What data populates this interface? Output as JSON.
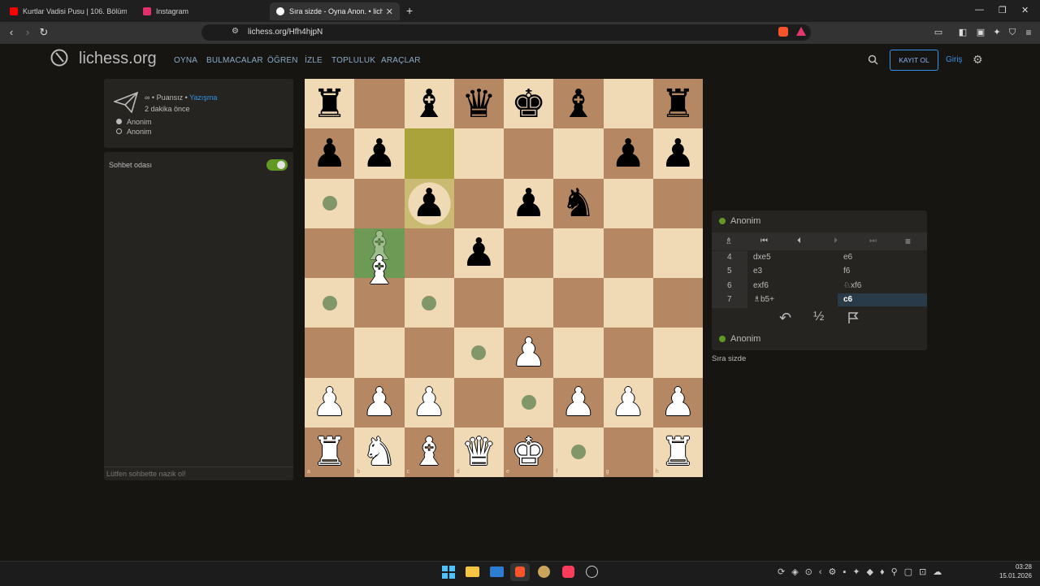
{
  "browser": {
    "tabs": [
      {
        "title": "Kurtlar Vadisi Pusu | 106. Bölüm | Yük",
        "icon": "youtube-icon",
        "color": "#ff0000"
      },
      {
        "title": "Instagram",
        "icon": "instagram-icon",
        "color": "#e1306c"
      },
      {
        "title": "Sıra sizde - Oyna Anon. • lich",
        "icon": "lichess-icon",
        "color": "#ffffff"
      }
    ],
    "url": "lichess.org/Hfh4hjpN"
  },
  "header": {
    "logo": "lichess.org",
    "nav": [
      "OYNA",
      "BULMACALAR",
      "ÖĞREN",
      "İZLE",
      "TOPLULUK",
      "ARAÇLAR"
    ],
    "signup": "KAYIT OL",
    "login": "Giriş"
  },
  "game_info": {
    "mode": "∞ • Puansız • ",
    "mode_link": "Yazışma",
    "time": "2 dakika önce",
    "players": [
      "Anonim",
      "Anonim"
    ]
  },
  "chat": {
    "title": "Sohbet odası",
    "toggle_on": true,
    "placeholder": "Lütfen sohbette nazik ol!"
  },
  "board": {
    "files": [
      "a",
      "b",
      "c",
      "d",
      "e",
      "f",
      "g",
      "h"
    ],
    "ranks": [
      "8",
      "7",
      "6",
      "5",
      "4",
      "3",
      "2",
      "1"
    ],
    "position": [
      [
        "r",
        "",
        "b",
        "q",
        "k",
        "b",
        "",
        "r"
      ],
      [
        "p",
        "p",
        "",
        "",
        "",
        "",
        "p",
        "p"
      ],
      [
        "",
        "",
        "p",
        "",
        "p",
        "n",
        "",
        ""
      ],
      [
        "",
        "",
        "",
        "p",
        "",
        "",
        "",
        ""
      ],
      [
        "",
        "",
        "",
        "",
        "",
        "",
        "",
        ""
      ],
      [
        "",
        "",
        "",
        "",
        "P",
        "",
        "",
        ""
      ],
      [
        "P",
        "P",
        "P",
        "",
        "",
        "P",
        "P",
        "P"
      ],
      [
        "R",
        "N",
        "B",
        "Q",
        "K",
        "",
        "",
        "R"
      ]
    ],
    "last_move": [
      "c7",
      "c6"
    ],
    "selected": "b5",
    "dragging_piece": "B",
    "dests": [
      "a6",
      "a4",
      "c4",
      "d3",
      "e2",
      "f1"
    ]
  },
  "moves": {
    "top_player": "Anonim",
    "bottom_player": "Anonim",
    "list": [
      {
        "n": "4",
        "w": "dxe5",
        "b": "e6"
      },
      {
        "n": "5",
        "w": "e3",
        "b": "f6"
      },
      {
        "n": "6",
        "w": "exf6",
        "b": "♘xf6"
      },
      {
        "n": "7",
        "w": "♗b5+",
        "b": "c6"
      }
    ],
    "half": "½",
    "status": "Sıra sizde"
  },
  "taskbar": {
    "time": "03:28",
    "date": "15.01.2026"
  }
}
